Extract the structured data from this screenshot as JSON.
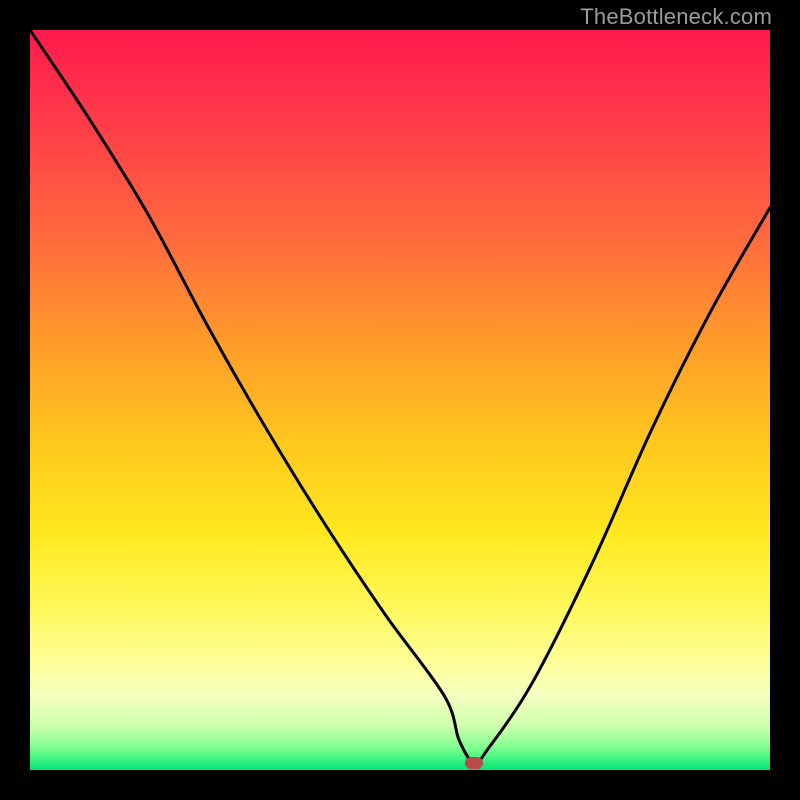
{
  "watermark": "TheBottleneck.com",
  "chart_data": {
    "type": "line",
    "title": "",
    "xlabel": "",
    "ylabel": "",
    "xlim": [
      0,
      100
    ],
    "ylim": [
      0,
      100
    ],
    "grid": false,
    "series": [
      {
        "name": "bottleneck-curve",
        "x": [
          0,
          8,
          16,
          24,
          32,
          40,
          48,
          56,
          58,
          60,
          62,
          68,
          76,
          84,
          92,
          100
        ],
        "values": [
          100,
          88,
          75,
          60,
          46,
          33,
          21,
          10,
          4,
          1,
          3,
          12,
          28,
          46,
          62,
          76
        ]
      }
    ],
    "marker": {
      "x": 60,
      "y": 1,
      "color": "#b84a4a"
    },
    "gradient_stops": [
      {
        "pos": 0,
        "color": "#ff1a4d"
      },
      {
        "pos": 12,
        "color": "#ff3a4a"
      },
      {
        "pos": 28,
        "color": "#ff6a3d"
      },
      {
        "pos": 42,
        "color": "#ff9a2a"
      },
      {
        "pos": 56,
        "color": "#ffc81e"
      },
      {
        "pos": 68,
        "color": "#ffe81e"
      },
      {
        "pos": 78,
        "color": "#fff85a"
      },
      {
        "pos": 86,
        "color": "#fdff9e"
      },
      {
        "pos": 90,
        "color": "#f4ffc0"
      },
      {
        "pos": 94,
        "color": "#cfffad"
      },
      {
        "pos": 97,
        "color": "#7fff8f"
      },
      {
        "pos": 100,
        "color": "#00e676"
      }
    ]
  }
}
